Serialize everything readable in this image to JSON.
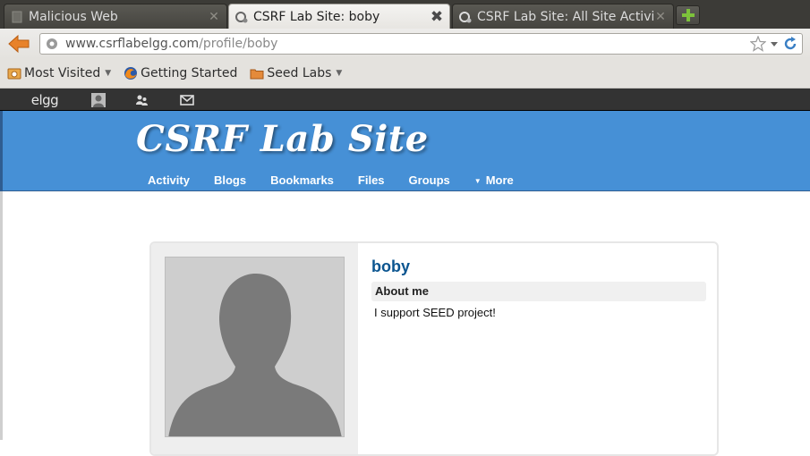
{
  "browser": {
    "tabs": [
      {
        "title": "Malicious Web",
        "active": false
      },
      {
        "title": "CSRF Lab Site: boby",
        "active": true
      },
      {
        "title": "CSRF Lab Site: All Site Activity",
        "active": false
      }
    ],
    "url": {
      "host": "www.csrflabelgg.com",
      "path": "/profile/boby"
    },
    "bookmarks": [
      {
        "label": "Most Visited",
        "icon": "most-visited-icon",
        "dropdown": true
      },
      {
        "label": "Getting Started",
        "icon": "firefox-icon",
        "dropdown": false
      },
      {
        "label": "Seed Labs",
        "icon": "folder-icon",
        "dropdown": true
      }
    ]
  },
  "topbar": {
    "logo": "elgg",
    "icons": [
      "elgg-logo-icon",
      "profile-icon",
      "friends-icon",
      "messages-icon"
    ]
  },
  "header": {
    "site_title": "CSRF Lab Site",
    "menu": [
      "Activity",
      "Blogs",
      "Bookmarks",
      "Files",
      "Groups",
      "More"
    ],
    "colors": {
      "header_bg": "#4690d6",
      "username": "#0b5590"
    }
  },
  "profile": {
    "username": "boby",
    "about_heading": "About me",
    "about_text": "I support SEED project!"
  }
}
